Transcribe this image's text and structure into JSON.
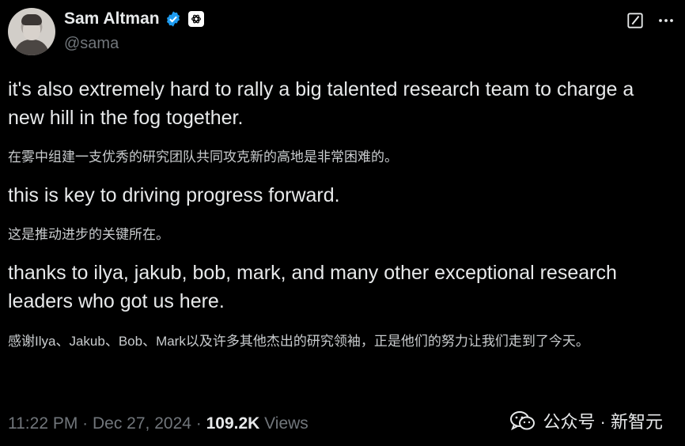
{
  "author": {
    "name": "Sam Altman",
    "handle": "@sama",
    "verified_color": "#1d9bf0"
  },
  "icons": {
    "verified": "verified-badge-icon",
    "org": "openai-logo-icon",
    "grok": "grok-icon",
    "more": "more-icon",
    "watermark": "wechat-icon"
  },
  "tweet": {
    "p1_en": "it's also extremely hard to rally a big talented research team to charge a new hill in the fog together.",
    "p1_zh": "在雾中组建一支优秀的研究团队共同攻克新的高地是非常困难的。",
    "p2_en": "this is key to driving progress forward.",
    "p2_zh": "这是推动进步的关键所在。",
    "p3_en": "thanks to ilya, jakub, bob, mark, and many other exceptional research leaders who got us here.",
    "p3_zh": "感谢Ilya、Jakub、Bob、Mark以及许多其他杰出的研究领袖，正是他们的努力让我们走到了今天。"
  },
  "meta": {
    "time": "11:22 PM",
    "sep1": " · ",
    "date": "Dec 27, 2024",
    "sep2": " · ",
    "views_count": "109.2K",
    "views_label": " Views"
  },
  "watermark": {
    "text": "公众号 · 新智元"
  }
}
